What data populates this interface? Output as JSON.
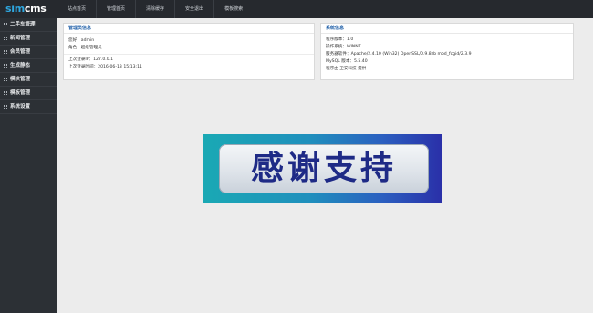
{
  "logo": {
    "part1": "sim",
    "part2": "cms"
  },
  "topnav": [
    {
      "label": "站点首页"
    },
    {
      "label": "管理首页"
    },
    {
      "label": "清除缓存"
    },
    {
      "label": "安全退出"
    },
    {
      "label": "模板搜索"
    }
  ],
  "sidebar": {
    "items": [
      {
        "label": "二手车管理"
      },
      {
        "label": "新闻管理"
      },
      {
        "label": "会员管理"
      },
      {
        "label": "生成静态"
      },
      {
        "label": "模块管理"
      },
      {
        "label": "模板管理"
      },
      {
        "label": "系统设置"
      }
    ]
  },
  "admin_panel": {
    "title": "管理员信息",
    "greeting": "您好：admin",
    "role": "角色：超级管理员",
    "last_ip": "上次登录IP：127.0.0.1",
    "last_time": "上次登录时间：2016-06-13 15:13:11"
  },
  "system_panel": {
    "title": "系统信息",
    "version": "程序版本：1.0",
    "os": "操作系统：WINNT",
    "server": "服务器软件：Apache/2.4.10 (Win32) OpenSSL/0.9.8zb mod_fcgid/2.3.9",
    "mysql": "MySQL 版本：5.5.40",
    "provider": "程序由 卫安科技 提供"
  },
  "banner": {
    "text": "感谢支持"
  }
}
